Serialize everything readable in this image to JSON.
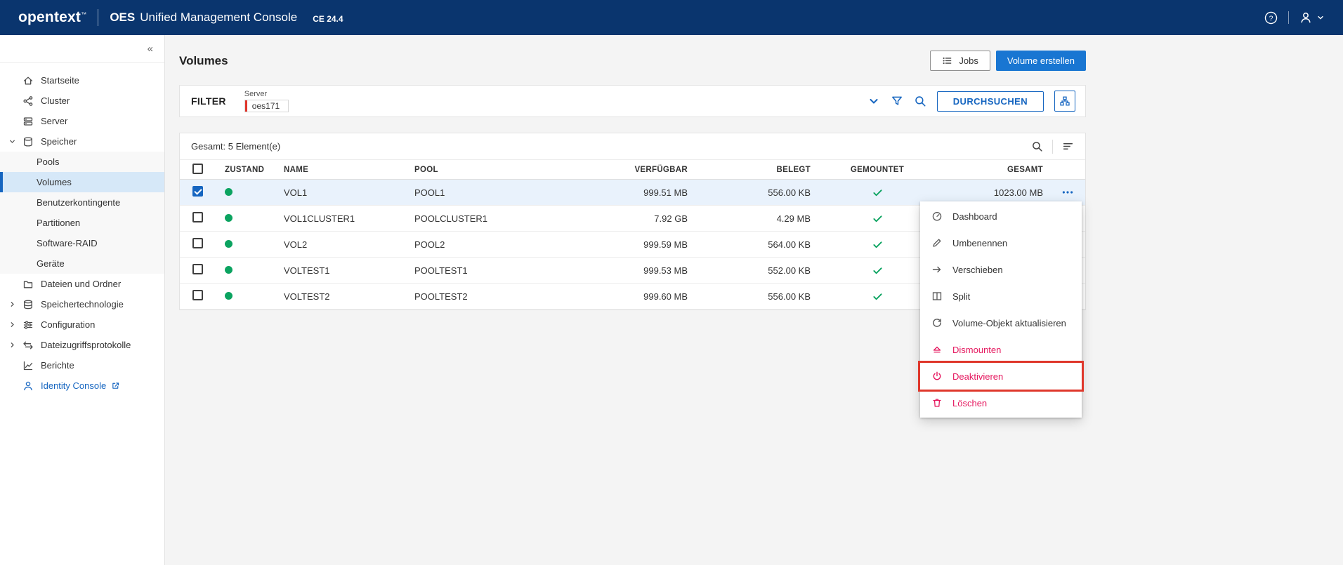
{
  "header": {
    "logo": "opentext",
    "trademark": "™",
    "product_prefix": "OES",
    "product_name": "Unified Management Console",
    "version": "CE 24.4"
  },
  "sidebar": {
    "collapse": "«",
    "items": [
      {
        "label": "Startseite"
      },
      {
        "label": "Cluster"
      },
      {
        "label": "Server"
      },
      {
        "label": "Speicher"
      },
      {
        "label": "Pools"
      },
      {
        "label": "Volumes"
      },
      {
        "label": "Benutzerkontingente"
      },
      {
        "label": "Partitionen"
      },
      {
        "label": "Software-RAID"
      },
      {
        "label": "Geräte"
      },
      {
        "label": "Dateien und Ordner"
      },
      {
        "label": "Speichertechnologie"
      },
      {
        "label": "Configuration"
      },
      {
        "label": "Dateizugriffsprotokolle"
      },
      {
        "label": "Berichte"
      },
      {
        "label": "Identity Console"
      }
    ]
  },
  "main": {
    "title": "Volumes",
    "toolbar": {
      "jobs": "Jobs",
      "create": "Volume erstellen"
    },
    "filter": {
      "label": "FILTER",
      "server_label": "Server",
      "server_value": "oes171",
      "search_button": "DURCHSUCHEN"
    },
    "table": {
      "summary": "Gesamt: 5 Element(e)",
      "headers": {
        "state": "ZUSTAND",
        "name": "NAME",
        "pool": "POOL",
        "available": "VERFÜGBAR",
        "used": "BELEGT",
        "mounted": "GEMOUNTET",
        "total": "GESAMT"
      },
      "rows": [
        {
          "name": "VOL1",
          "pool": "POOL1",
          "available": "999.51 MB",
          "used": "556.00 KB",
          "total": "1023.00 MB",
          "selected": true,
          "mounted": true
        },
        {
          "name": "VOL1CLUSTER1",
          "pool": "POOLCLUSTER1",
          "available": "7.92 GB",
          "used": "4.29 MB",
          "total": "",
          "selected": false,
          "mounted": true
        },
        {
          "name": "VOL2",
          "pool": "POOL2",
          "available": "999.59 MB",
          "used": "564.00 KB",
          "total": "",
          "selected": false,
          "mounted": true
        },
        {
          "name": "VOLTEST1",
          "pool": "POOLTEST1",
          "available": "999.53 MB",
          "used": "552.00 KB",
          "total": "",
          "selected": false,
          "mounted": true
        },
        {
          "name": "VOLTEST2",
          "pool": "POOLTEST2",
          "available": "999.60 MB",
          "used": "556.00 KB",
          "total": "",
          "selected": false,
          "mounted": true
        }
      ]
    }
  },
  "context_menu": {
    "items": [
      {
        "label": "Dashboard",
        "danger": false
      },
      {
        "label": "Umbenennen",
        "danger": false
      },
      {
        "label": "Verschieben",
        "danger": false
      },
      {
        "label": "Split",
        "danger": false
      },
      {
        "label": "Volume-Objekt aktualisieren",
        "danger": false
      },
      {
        "label": "Dismounten",
        "danger": true
      },
      {
        "label": "Deaktivieren",
        "danger": true,
        "annotated": true
      },
      {
        "label": "Löschen",
        "danger": true
      }
    ]
  },
  "colors": {
    "header_bg": "#0a356e",
    "primary_blue": "#1976d2",
    "accent_blue": "#1565c0",
    "success_green": "#0ba360",
    "danger_pink": "#e5175e",
    "annotation_red": "#df372b",
    "selected_row_bg": "#e9f2fc",
    "active_nav_bg": "#d6e8f8"
  }
}
